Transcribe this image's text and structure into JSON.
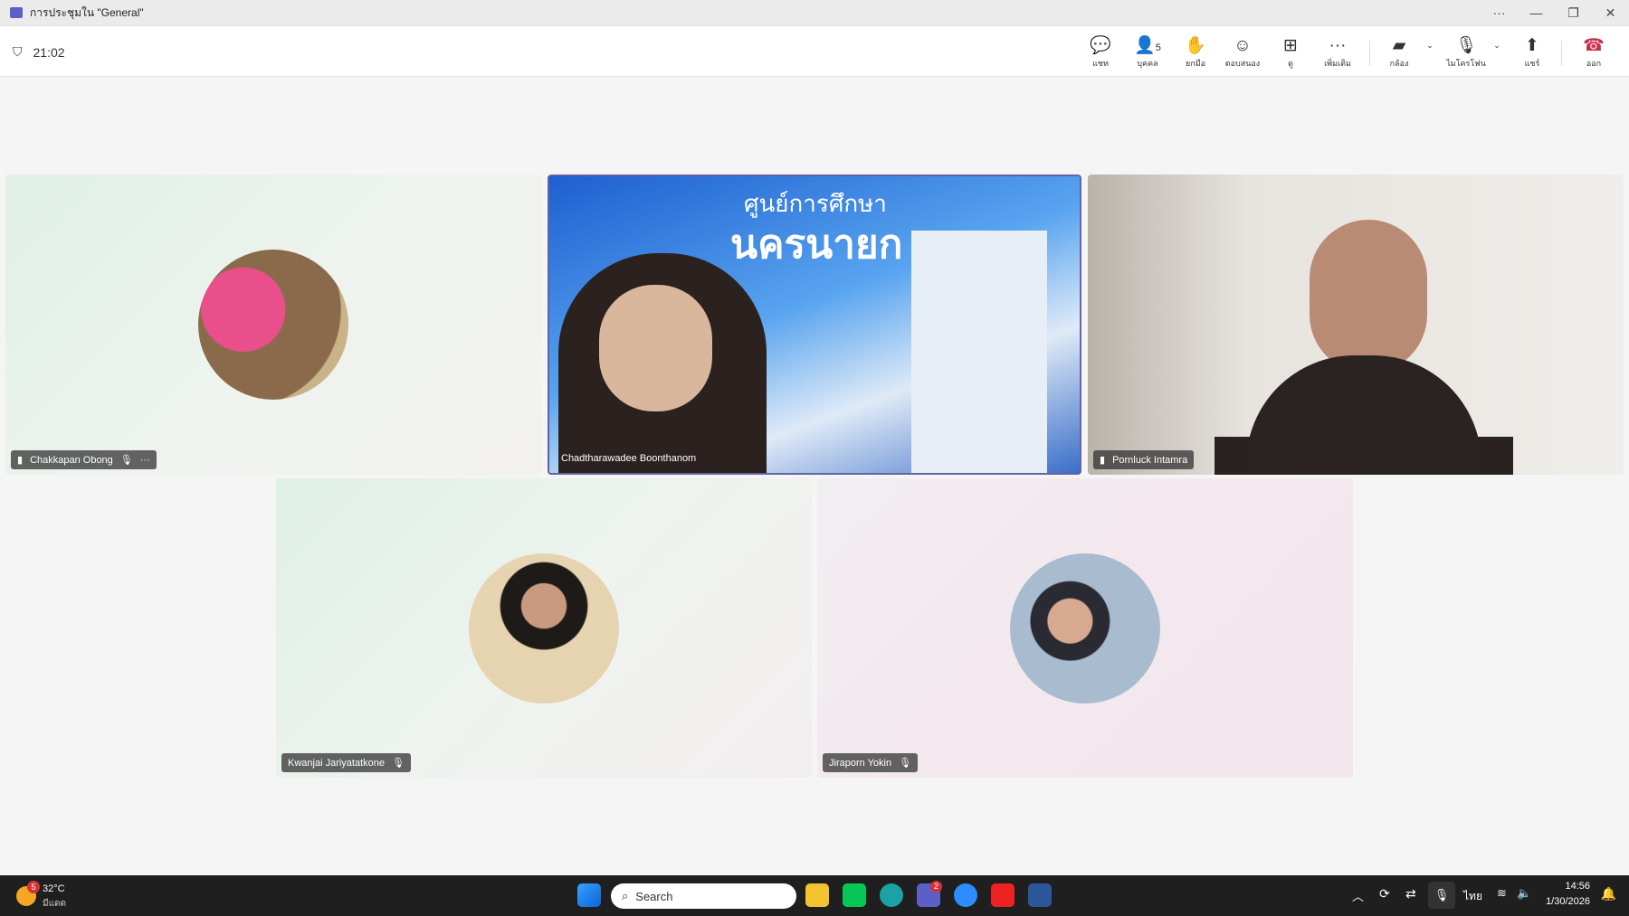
{
  "window": {
    "title": "การประชุมใน \"General\"",
    "more": "···",
    "minimize": "—",
    "restore": "❐",
    "close": "✕"
  },
  "toolbar": {
    "timer": "21:02",
    "buttons": [
      {
        "label": "แชท",
        "icon": "chat-icon",
        "glyph": "💬"
      },
      {
        "label": "บุคคล",
        "icon": "people-icon",
        "glyph": "👤",
        "count": "5"
      },
      {
        "label": "ยกมือ",
        "icon": "raise-hand-icon",
        "glyph": "✋"
      },
      {
        "label": "ตอบสนอง",
        "icon": "react-icon",
        "glyph": "☺"
      },
      {
        "label": "ดู",
        "icon": "view-icon",
        "glyph": "⊞"
      },
      {
        "label": "เพิ่มเติม",
        "icon": "more-icon",
        "glyph": "···"
      },
      {
        "label": "กล้อง",
        "icon": "camera-off-icon",
        "glyph": "▰"
      },
      {
        "label": "ไมโครโฟน",
        "icon": "mic-off-icon",
        "glyph": "🎙"
      },
      {
        "label": "แชร์",
        "icon": "share-icon",
        "glyph": "⬆"
      },
      {
        "label": "ออก",
        "icon": "leave-icon",
        "glyph": "☎"
      }
    ]
  },
  "participants": [
    {
      "name": "Chakkapan Obong"
    },
    {
      "name": "Chadtharawadee Boonthanom",
      "banner_top": "ศูนย์การศึกษา",
      "banner_main": "นครนายก"
    },
    {
      "name": "Pornluck Intamra"
    },
    {
      "name": "Kwanjai Jariyatatkone"
    },
    {
      "name": "Jiraporn Yokin"
    }
  ],
  "taskbar": {
    "weather_temp": "32°C",
    "weather_text": "มีแดด",
    "weather_badge": "5",
    "search": "Search",
    "teams_badge": "2",
    "lang": "ไทย",
    "time": "14:56",
    "date": "1/30/2026"
  }
}
